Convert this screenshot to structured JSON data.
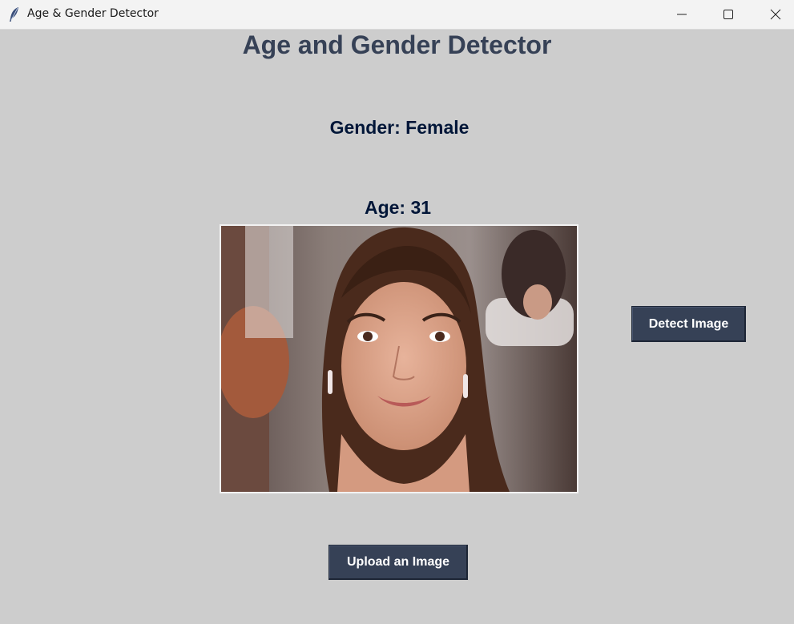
{
  "window": {
    "title": "Age & Gender Detector",
    "icon": "feather-icon"
  },
  "main": {
    "heading": "Age and Gender Detector",
    "gender_label": "Gender: Female",
    "age_label": "Age: 31",
    "photo": "woman-portrait-photo"
  },
  "buttons": {
    "detect_label": "Detect Image",
    "upload_label": "Upload an Image"
  },
  "colors": {
    "background": "#cdcdcd",
    "heading": "#364156",
    "result_text": "#011638",
    "button_bg": "#364156",
    "button_text": "#ffffff"
  }
}
